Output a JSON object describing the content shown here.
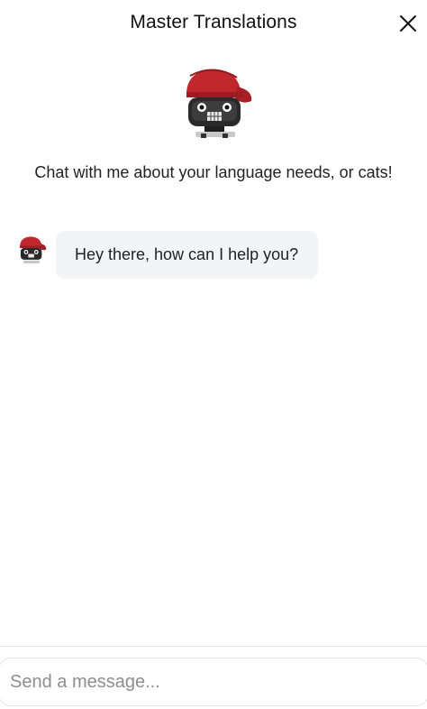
{
  "header": {
    "title": "Master Translations"
  },
  "intro": {
    "text": "Chat with me about your language needs, or cats!"
  },
  "messages": [
    {
      "sender": "bot",
      "text": "Hey there, how can I help you?"
    }
  ],
  "composer": {
    "placeholder": "Send a message..."
  },
  "colors": {
    "bubble_bg": "#f3f4f6",
    "hat_red": "#c1272d",
    "text": "#222222"
  },
  "icons": {
    "close": "close-icon",
    "avatar": "robot-mascot-avatar"
  }
}
